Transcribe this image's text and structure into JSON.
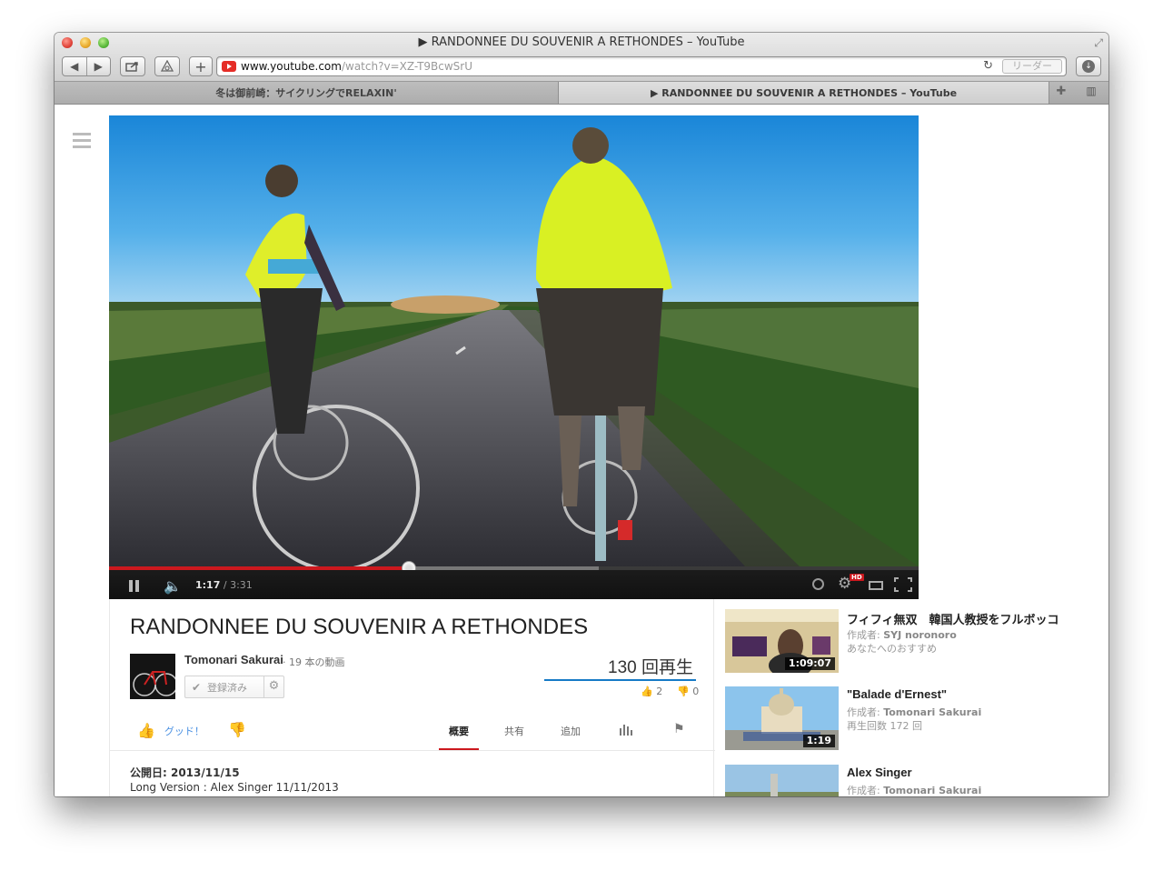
{
  "window": {
    "title": "▶ RANDONNEE DU SOUVENIR A RETHONDES – YouTube"
  },
  "toolbar": {
    "back_icon": "◀",
    "forward_icon": "▶",
    "add_icon": "+",
    "reload_icon": "↻",
    "reader_label": "リーダー"
  },
  "address": {
    "host": "www.youtube.com",
    "path": "/watch?v=XZ-T9BcwSrU"
  },
  "tabs": [
    {
      "label": "冬は御前崎：サイクリングでRELAXIN'"
    },
    {
      "label": "▶ RANDONNEE DU SOUVENIR A RETHONDES – YouTube"
    }
  ],
  "player": {
    "current_time": "1:17",
    "duration": "3:31",
    "played_fraction": 0.37,
    "buffered_fraction": 0.605,
    "hd_label": "HD"
  },
  "video": {
    "title": "RANDONNEE DU SOUVENIR A RETHONDES",
    "channel_name": "Tomonari Sakurai",
    "video_count": "· 19 本の動画",
    "subscribe_label": "登録済み",
    "view_count": "130 回再生",
    "likes": "2",
    "dislikes": "0",
    "like_label": "グッド！",
    "tabs": {
      "overview": "概要",
      "share": "共有",
      "add": "追加"
    },
    "published": "公開日: 2013/11/15",
    "description": "Long Version :   Alex Singer 11/11/2013"
  },
  "related": [
    {
      "title": "フィフィ無双　韓国人教授をフルボッコ",
      "author_prefix": "作成者: ",
      "author": "SYJ noronoro",
      "meta": "あなたへのおすすめ",
      "duration": "1:09:07"
    },
    {
      "title": "\"Balade d'Ernest\"",
      "author_prefix": "作成者: ",
      "author": "Tomonari Sakurai",
      "meta": "再生回数 172 回",
      "duration": "1:19"
    },
    {
      "title": "Alex Singer",
      "author_prefix": "作成者: ",
      "author": "Tomonari Sakurai",
      "meta": "",
      "duration": ""
    }
  ]
}
